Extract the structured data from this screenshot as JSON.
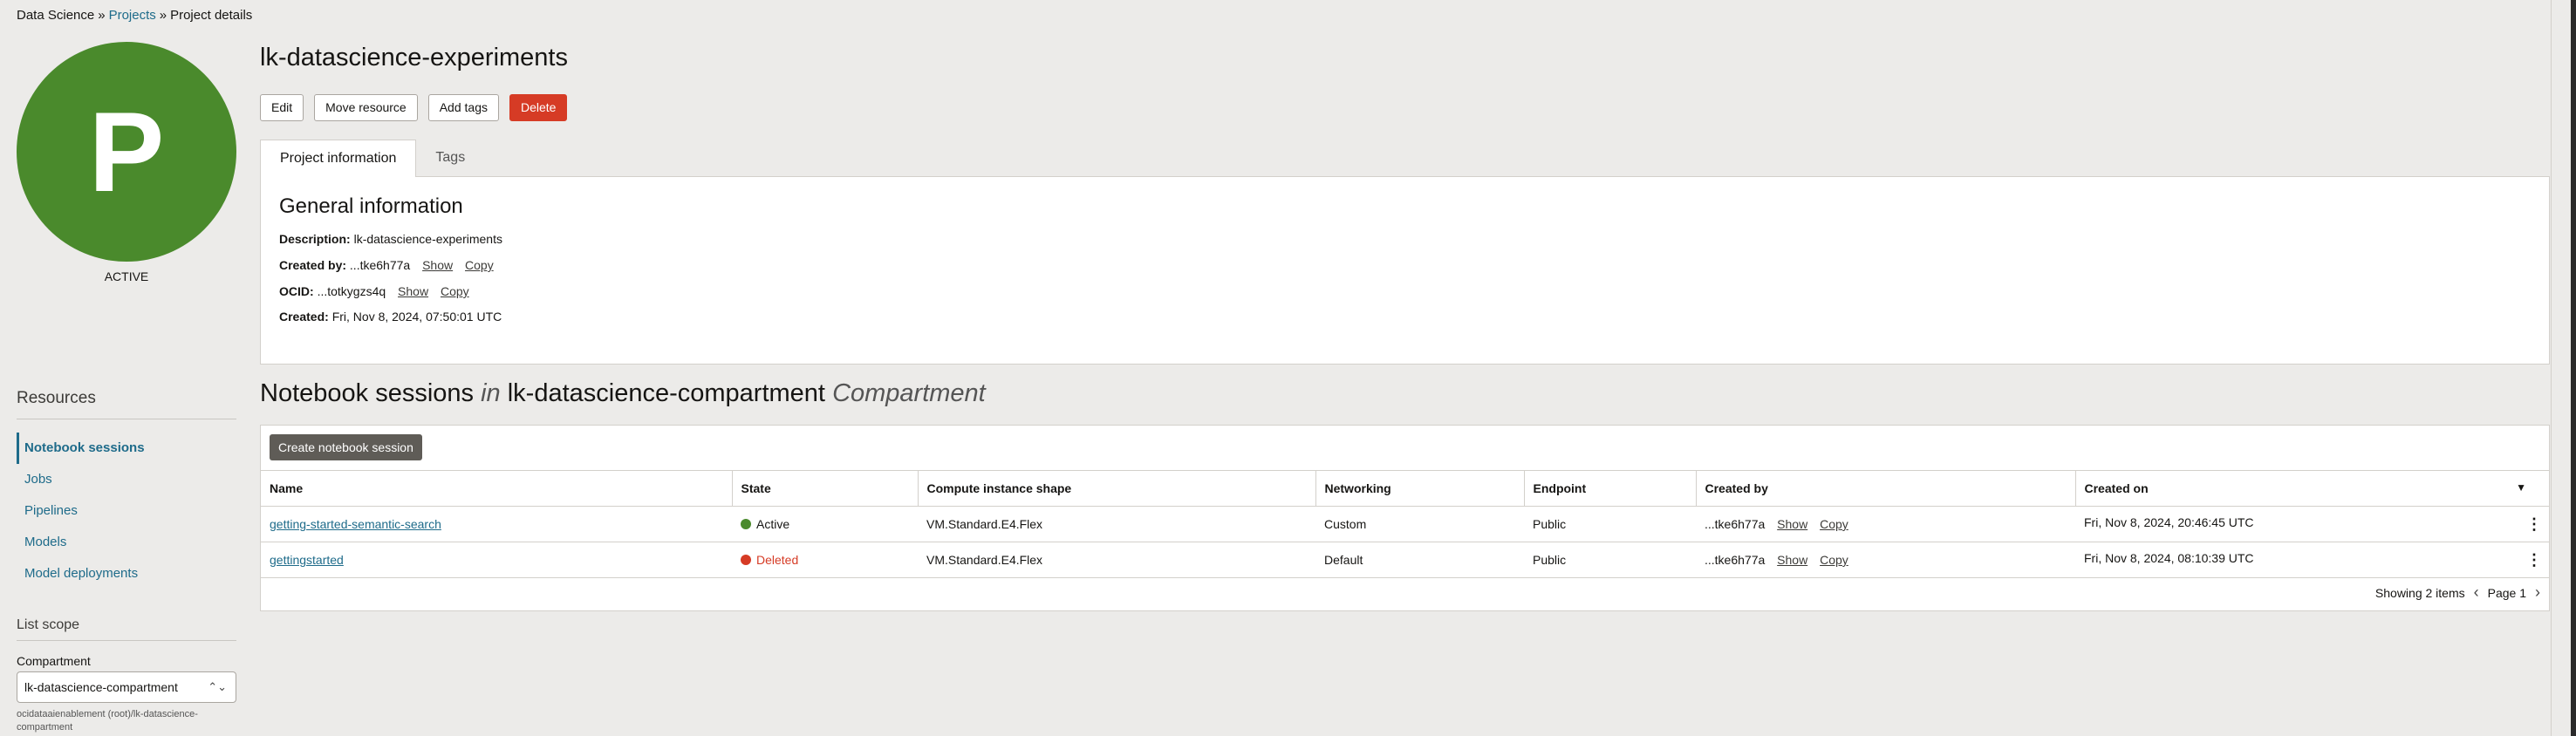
{
  "breadcrumb": {
    "root": "Data Science",
    "projects": "Projects",
    "current": "Project details",
    "separator": "»"
  },
  "avatar": {
    "letter": "P",
    "status": "ACTIVE",
    "color": "#4a8a2c"
  },
  "project": {
    "title": "lk-datascience-experiments"
  },
  "actions": {
    "edit": "Edit",
    "move": "Move resource",
    "add_tags": "Add tags",
    "delete": "Delete"
  },
  "tabs": {
    "project_info": "Project information",
    "tags": "Tags"
  },
  "general_info": {
    "heading": "General information",
    "description_label": "Description:",
    "description_value": "lk-datascience-experiments",
    "created_by_label": "Created by:",
    "created_by_value": "...tke6h77a",
    "ocid_label": "OCID:",
    "ocid_value": "...totkygzs4q",
    "created_label": "Created:",
    "created_value": "Fri, Nov 8, 2024, 07:50:01 UTC",
    "show_label": "Show",
    "copy_label": "Copy"
  },
  "resources": {
    "title": "Resources",
    "items": [
      "Notebook sessions",
      "Jobs",
      "Pipelines",
      "Models",
      "Model deployments"
    ]
  },
  "list_scope": {
    "title": "List scope",
    "compartment_label": "Compartment",
    "compartment_value": "lk-datascience-compartment",
    "compartment_path": "ocidataaienablement (root)/lk-datascience-compartment"
  },
  "notebooks": {
    "title_main": "Notebook sessions",
    "title_in": "in",
    "title_compartment": "lk-datascience-compartment",
    "title_suffix": "Compartment",
    "create_button": "Create notebook session",
    "columns": [
      "Name",
      "State",
      "Compute instance shape",
      "Networking",
      "Endpoint",
      "Created by",
      "Created on"
    ],
    "rows": [
      {
        "name": "getting-started-semantic-search",
        "state": "Active",
        "shape": "VM.Standard.E4.Flex",
        "networking": "Custom",
        "endpoint": "Public",
        "created_by": "...tke6h77a",
        "created_on": "Fri, Nov 8, 2024, 20:46:45 UTC"
      },
      {
        "name": "gettingstarted",
        "state": "Deleted",
        "shape": "VM.Standard.E4.Flex",
        "networking": "Default",
        "endpoint": "Public",
        "created_by": "...tke6h77a",
        "created_on": "Fri, Nov 8, 2024, 08:10:39 UTC"
      }
    ],
    "show_label": "Show",
    "copy_label": "Copy",
    "showing": "Showing 2 items",
    "page": "Page 1"
  },
  "colors": {
    "link": "#1e6b8a",
    "danger": "#d63b25",
    "active": "#4a8a2c"
  }
}
